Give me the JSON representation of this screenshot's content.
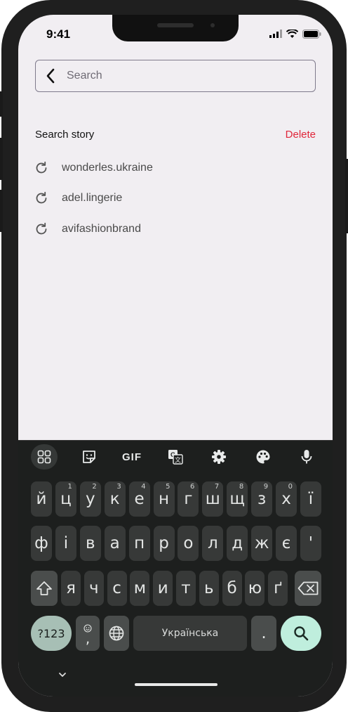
{
  "status_bar": {
    "time": "9:41"
  },
  "search": {
    "placeholder": "Search"
  },
  "story": {
    "title": "Search story",
    "delete_label": "Delete",
    "items": [
      "wonderles.ukraine",
      "adel.lingerie",
      "avifashionbrand"
    ]
  },
  "keyboard": {
    "toolbar": {
      "gif_label": "GIF"
    },
    "row1": [
      {
        "char": "й",
        "hint": ""
      },
      {
        "char": "ц",
        "hint": "1"
      },
      {
        "char": "у",
        "hint": "2"
      },
      {
        "char": "к",
        "hint": "3"
      },
      {
        "char": "е",
        "hint": "4"
      },
      {
        "char": "н",
        "hint": "5"
      },
      {
        "char": "г",
        "hint": "6"
      },
      {
        "char": "ш",
        "hint": "7"
      },
      {
        "char": "щ",
        "hint": "8"
      },
      {
        "char": "з",
        "hint": "9"
      },
      {
        "char": "х",
        "hint": "0"
      },
      {
        "char": "ї",
        "hint": ""
      }
    ],
    "row2": [
      "ф",
      "і",
      "в",
      "а",
      "п",
      "р",
      "о",
      "л",
      "д",
      "ж",
      "є",
      "'"
    ],
    "row3": [
      "я",
      "ч",
      "с",
      "м",
      "и",
      "т",
      "ь",
      "б",
      "ю",
      "ґ"
    ],
    "symbols_label": "?123",
    "emoji_comma_label": ",",
    "space_label": "Українська",
    "period_label": "."
  },
  "colors": {
    "screen_bg": "#f1eef2",
    "delete": "#e0263a",
    "keyboard_bg": "#1d1f1e",
    "key_bg": "#373938",
    "enter_bg": "#bfeedd",
    "symbols_bg": "#a7bfb5"
  },
  "icons": [
    "back-arrow-icon",
    "history-icon",
    "apps-grid-icon",
    "sticker-icon",
    "translate-icon",
    "settings-icon",
    "palette-icon",
    "microphone-icon",
    "shift-icon",
    "backspace-icon",
    "emoji-icon",
    "globe-icon",
    "search-icon",
    "chevron-down-icon"
  ]
}
